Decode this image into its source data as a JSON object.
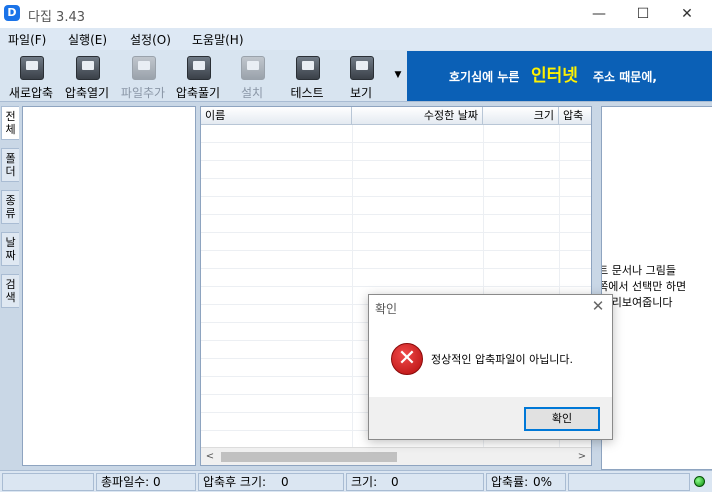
{
  "window": {
    "title": "다집 3.43",
    "app_icon_glyph": "D",
    "controls": {
      "minimize": "—",
      "maximize": "☐",
      "close": "✕"
    }
  },
  "menu": [
    "파일(F)",
    "실행(E)",
    "설정(O)",
    "도움말(H)"
  ],
  "toolbar": {
    "buttons": [
      {
        "label": "새로압축",
        "icon": "new-archive-icon",
        "enabled": true
      },
      {
        "label": "압축열기",
        "icon": "open-archive-icon",
        "enabled": true
      },
      {
        "label": "파일추가",
        "icon": "add-file-icon",
        "enabled": false
      },
      {
        "label": "압축풀기",
        "icon": "extract-icon",
        "enabled": true
      },
      {
        "label": "설치",
        "icon": "install-icon",
        "enabled": false
      },
      {
        "label": "테스트",
        "icon": "test-icon",
        "enabled": true
      },
      {
        "label": "보기",
        "icon": "view-icon",
        "enabled": true
      }
    ],
    "more_glyph": "▼"
  },
  "banner": {
    "pre": "호기심에 누른",
    "highlight": "인터넷",
    "post": "주소 때문에,",
    "bg_color": "#0b60b6",
    "highlight_color": "#fff200"
  },
  "side_tabs": [
    "전\n체",
    "폴\n더",
    "종\n류",
    "날\n짜",
    "검\n색"
  ],
  "file_list": {
    "columns": [
      "이름",
      "수정한 날짜",
      "크기",
      "압축"
    ],
    "rows": [],
    "scroll_left": "<",
    "scroll_right": ">"
  },
  "preview": {
    "lines": [
      "스트 문서나 그림들",
      "왼쪽에서 선택만 하면",
      "에 미리보여줍니다"
    ]
  },
  "statusbar": {
    "total_files_label": "총파일수:",
    "total_files_value": "0",
    "compressed_size_label": "압축후 크기:",
    "compressed_size_value": "0",
    "size_label": "크기:",
    "size_value": "0",
    "ratio_label": "압축률:",
    "ratio_value": "0%"
  },
  "dialog": {
    "title": "확인",
    "close_glyph": "✕",
    "icon": "error-icon",
    "icon_glyph": "✕",
    "message": "정상적인 압축파일이 아닙니다.",
    "ok_label": "확인"
  }
}
